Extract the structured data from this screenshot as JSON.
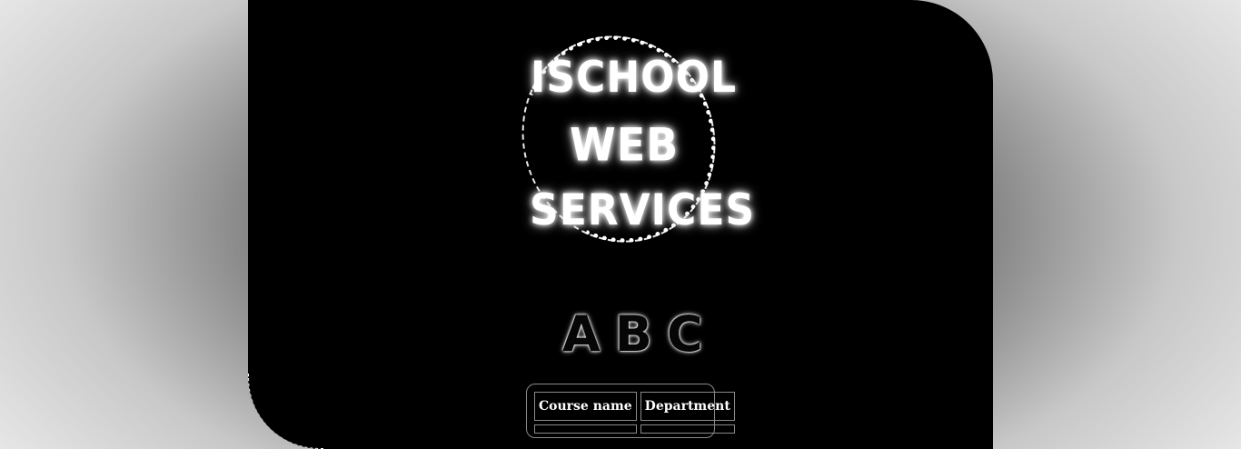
{
  "logo": {
    "line1": "ISCHOOL",
    "line2": "WEB",
    "line3": "SERVICES"
  },
  "abc_text": "ABC",
  "table": {
    "headers": [
      "Course name",
      "Department"
    ],
    "rows": [
      [
        "",
        ""
      ]
    ]
  },
  "colors": {
    "panel": "#000000",
    "text": "#ffffff",
    "border": "#8a8a8a"
  }
}
